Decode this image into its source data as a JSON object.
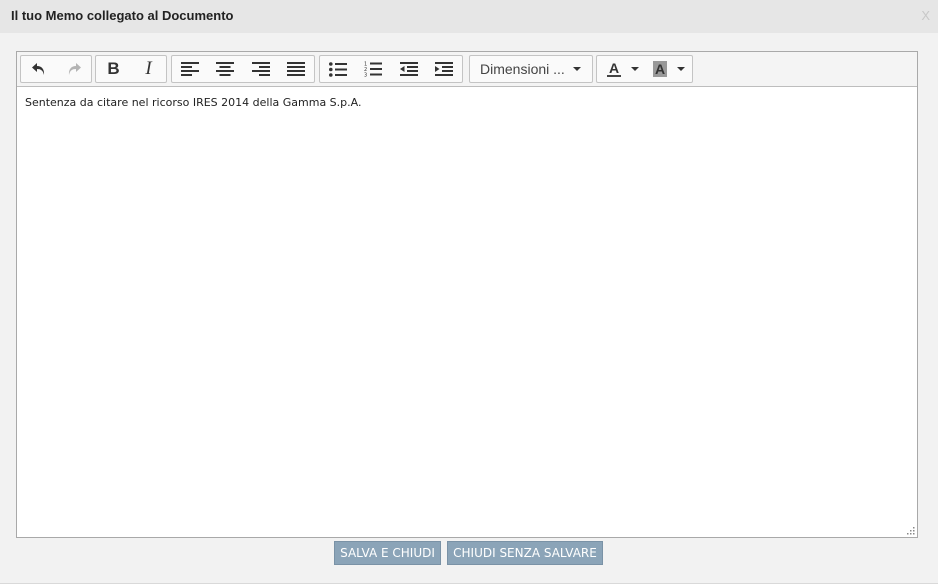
{
  "dialog": {
    "title": "Il tuo Memo collegato al Documento",
    "close_label": "X"
  },
  "toolbar": {
    "undo_icon": "undo-icon",
    "redo_icon": "redo-icon",
    "bold_label": "B",
    "italic_label": "I",
    "align_icons": [
      "align-left-icon",
      "align-center-icon",
      "align-right-icon",
      "align-justify-icon"
    ],
    "list_icons": [
      "bullet-list-icon",
      "numbered-list-icon",
      "outdent-icon",
      "indent-icon"
    ],
    "font_size_label": "Dimensioni ...",
    "text_color_label": "A",
    "bg_color_label": "A"
  },
  "editor": {
    "content": "Sentenza da citare nel ricorso IRES 2014 della Gamma S.p.A."
  },
  "footer": {
    "save_label": "SALVA E CHIUDI",
    "close_label": "CHIUDI SENZA SALVARE"
  },
  "colors": {
    "button_bg": "#8ba4b8",
    "titlebar_bg": "#e6e6e6",
    "dialog_bg": "#f2f2f2"
  }
}
